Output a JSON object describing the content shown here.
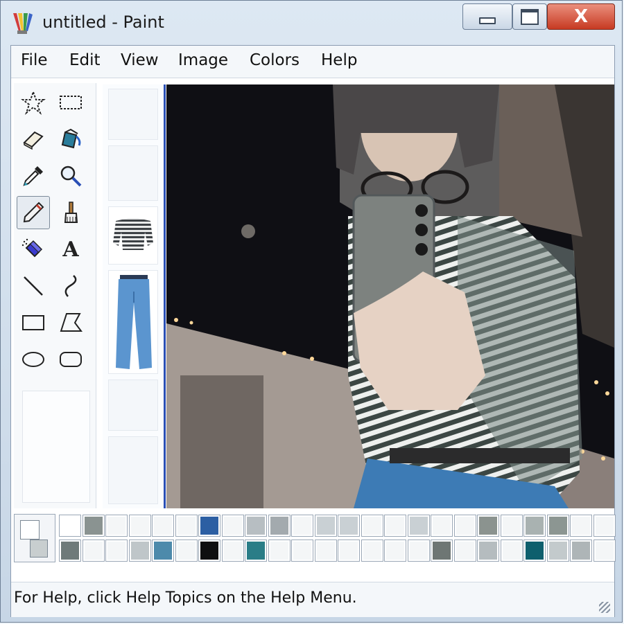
{
  "window": {
    "title": "untitled - Paint",
    "controls": {
      "minimize": "minimize",
      "maximize": "maximize",
      "close": "X"
    }
  },
  "menu": [
    "File",
    "Edit",
    "View",
    "Image",
    "Colors",
    "Help"
  ],
  "tools": [
    {
      "name": "free-form-select-icon"
    },
    {
      "name": "rectangle-select-icon"
    },
    {
      "name": "eraser-icon"
    },
    {
      "name": "fill-bucket-icon"
    },
    {
      "name": "color-picker-icon"
    },
    {
      "name": "magnifier-icon"
    },
    {
      "name": "pencil-icon",
      "selected": true
    },
    {
      "name": "brush-icon"
    },
    {
      "name": "airbrush-icon"
    },
    {
      "name": "text-icon",
      "glyph": "A"
    },
    {
      "name": "line-icon"
    },
    {
      "name": "curve-icon"
    },
    {
      "name": "rectangle-icon"
    },
    {
      "name": "polygon-icon"
    },
    {
      "name": "ellipse-icon"
    },
    {
      "name": "rounded-rectangle-icon"
    }
  ],
  "palette": {
    "colors": [
      "#ffffff",
      "#8a9391",
      "#f4f6f7",
      "#f4f6f7",
      "#f4f6f7",
      "#f4f6f7",
      "#2c5fa3",
      "#f4f6f7",
      "#b7bec2",
      "#a3aaae",
      "#f4f6f7",
      "#c9d0d4",
      "#c9d0d4",
      "#f4f6f7",
      "#f4f6f7",
      "#c9d0d4",
      "#f4f6f7",
      "#f4f6f7",
      "#8b938f",
      "#f4f6f7",
      "#a9b2b1",
      "#8c9692",
      "#f4f6f7",
      "#f4f6f7",
      "#6f7a79",
      "#f4f6f7",
      "#f4f6f7",
      "#bfc6c9",
      "#4d8aab",
      "#f4f6f7",
      "#0f0f10",
      "#f4f6f7",
      "#2a7d87",
      "#f4f6f7",
      "#f4f6f7",
      "#f4f6f7",
      "#f4f6f7",
      "#f4f6f7",
      "#f4f6f7",
      "#f4f6f7",
      "#6e7674",
      "#f4f6f7",
      "#b5bcbf",
      "#f4f6f7",
      "#0e5f6d",
      "#c3cacc",
      "#aeb5b7",
      "#f4f6f7"
    ]
  },
  "status": {
    "text": "For Help, click Help Topics on the Help Menu."
  }
}
